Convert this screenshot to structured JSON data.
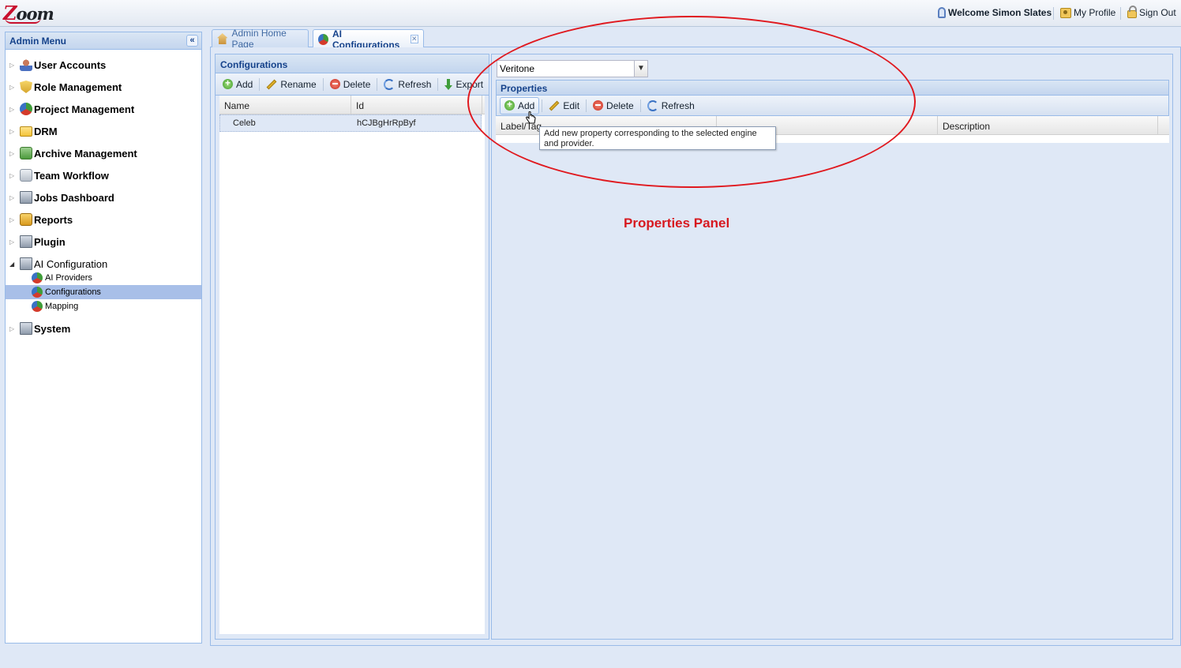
{
  "app": {
    "logo": "Zoom"
  },
  "topbar": {
    "welcome": "Welcome Simon Slates",
    "my_profile": "My Profile",
    "sign_out": "Sign Out"
  },
  "admin_menu": {
    "title": "Admin Menu",
    "items": [
      {
        "label": "User Accounts",
        "icon": "user-icon"
      },
      {
        "label": "Role Management",
        "icon": "shield-icon"
      },
      {
        "label": "Project Management",
        "icon": "globe-icon"
      },
      {
        "label": "DRM",
        "icon": "folder-icon"
      },
      {
        "label": "Archive Management",
        "icon": "archive-icon"
      },
      {
        "label": "Team Workflow",
        "icon": "team-icon"
      },
      {
        "label": "Jobs Dashboard",
        "icon": "monitor-icon"
      },
      {
        "label": "Reports",
        "icon": "report-icon"
      },
      {
        "label": "Plugin",
        "icon": "monitor-icon"
      },
      {
        "label": "AI Configuration",
        "icon": "monitor-icon",
        "expanded": true
      },
      {
        "label": "System",
        "icon": "monitor-icon"
      }
    ],
    "ai_children": [
      {
        "label": "AI Providers"
      },
      {
        "label": "Configurations",
        "selected": true
      },
      {
        "label": "Mapping"
      }
    ]
  },
  "tabs": [
    {
      "label": "Admin Home Page",
      "active": false
    },
    {
      "label": "AI Configurations",
      "active": true
    }
  ],
  "configurations": {
    "title": "Configurations",
    "toolbar": {
      "add": "Add",
      "rename": "Rename",
      "delete": "Delete",
      "refresh": "Refresh",
      "export": "Export"
    },
    "columns": [
      "Name",
      "Id"
    ],
    "rows": [
      {
        "name": "Celeb",
        "id": "hCJBgHrRpByf"
      }
    ]
  },
  "properties": {
    "engine_value": "Veritone",
    "title": "Properties",
    "toolbar": {
      "add": "Add",
      "edit": "Edit",
      "delete": "Delete",
      "refresh": "Refresh"
    },
    "columns": [
      "Label/Tag",
      "Description"
    ],
    "tooltip": "Add new property corresponding to the selected engine and provider."
  },
  "annotation": {
    "text": "Properties Panel",
    "color": "#d7191f"
  }
}
